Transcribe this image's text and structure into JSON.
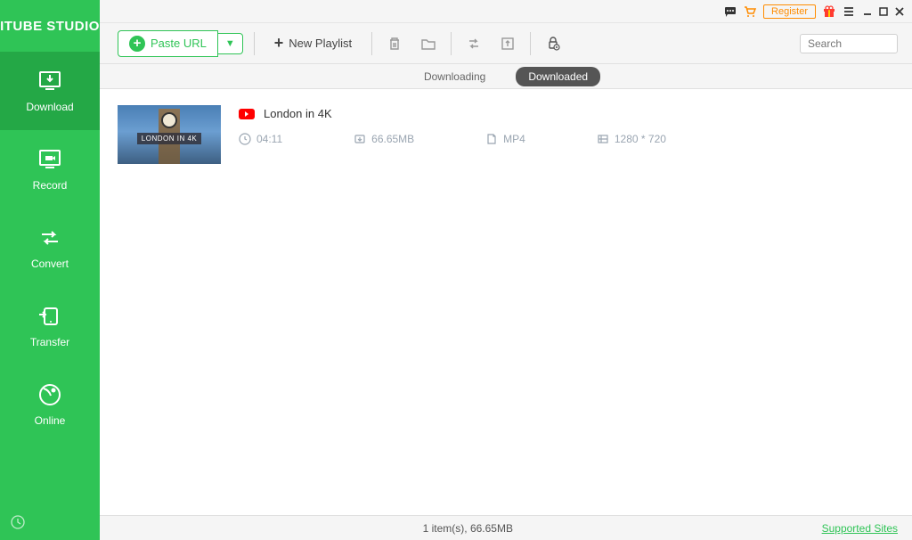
{
  "app": {
    "name": "ITUBE STUDIO"
  },
  "sidebar": {
    "items": [
      {
        "label": "Download"
      },
      {
        "label": "Record"
      },
      {
        "label": "Convert"
      },
      {
        "label": "Transfer"
      },
      {
        "label": "Online"
      }
    ]
  },
  "titlebar": {
    "register": "Register"
  },
  "toolbar": {
    "paste_url": "Paste URL",
    "new_playlist": "New Playlist",
    "search_placeholder": "Search"
  },
  "tabs": {
    "downloading": "Downloading",
    "downloaded": "Downloaded"
  },
  "videos": [
    {
      "title": "London in 4K",
      "thumb_label": "LONDON IN 4K",
      "duration": "04:11",
      "size": "66.65MB",
      "format": "MP4",
      "resolution": "1280 * 720"
    }
  ],
  "statusbar": {
    "summary": "1 item(s), 66.65MB",
    "link": "Supported Sites"
  }
}
